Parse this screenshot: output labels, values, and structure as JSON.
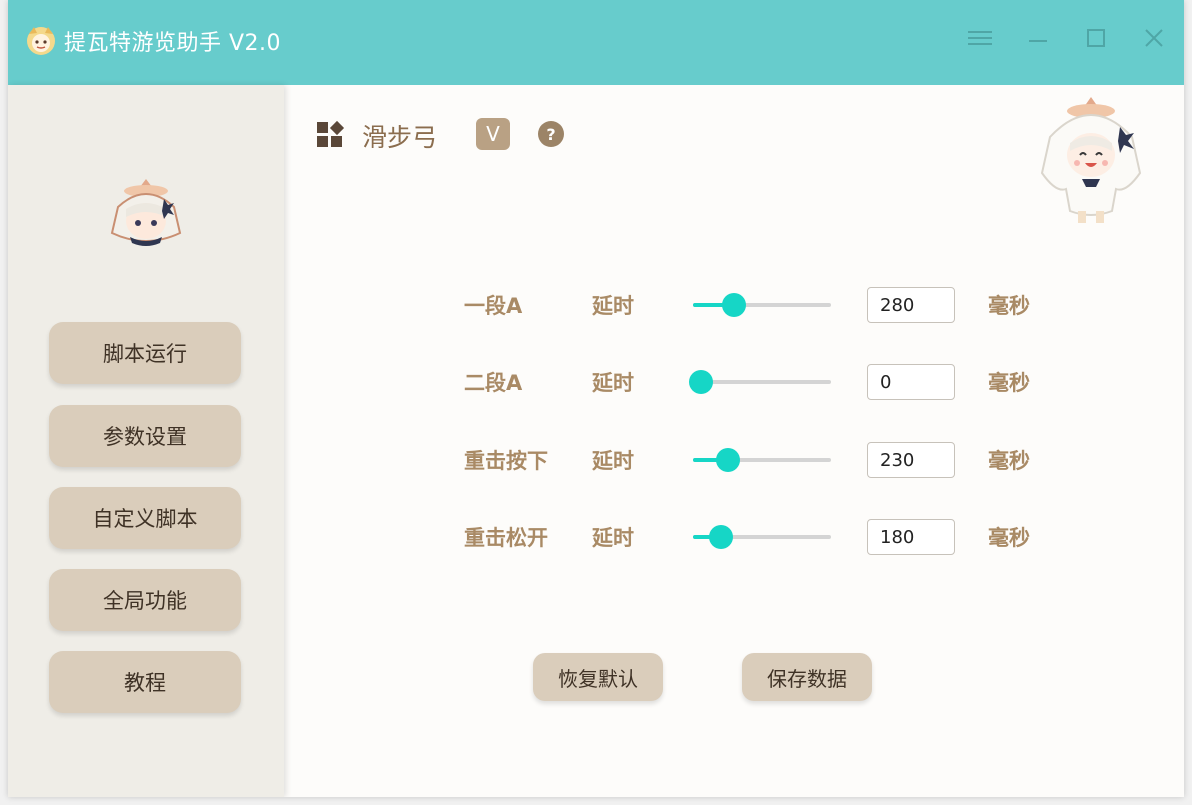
{
  "window": {
    "title": "提瓦特游览助手 V2.0",
    "accent": "#67cccc"
  },
  "sidebar": {
    "items": [
      {
        "label": "脚本运行"
      },
      {
        "label": "参数设置"
      },
      {
        "label": "自定义脚本"
      },
      {
        "label": "全局功能"
      },
      {
        "label": "教程"
      }
    ]
  },
  "section": {
    "title": "滑步弓",
    "badge": "V",
    "help": "?"
  },
  "params": {
    "rows": [
      {
        "label": "一段A",
        "delay": "延时",
        "value": "280",
        "unit": "毫秒",
        "level": 0.3
      },
      {
        "label": "二段A",
        "delay": "延时",
        "value": "0",
        "unit": "毫秒",
        "level": 0.0
      },
      {
        "label": "重击按下",
        "delay": "延时",
        "value": "230",
        "unit": "毫秒",
        "level": 0.25
      },
      {
        "label": "重击松开",
        "delay": "延时",
        "value": "180",
        "unit": "毫秒",
        "level": 0.2
      }
    ]
  },
  "actions": {
    "restore": "恢复默认",
    "save": "保存数据"
  },
  "colors": {
    "slider": "#16d6c6",
    "button": "#dacdbb",
    "label": "#a98a65"
  }
}
